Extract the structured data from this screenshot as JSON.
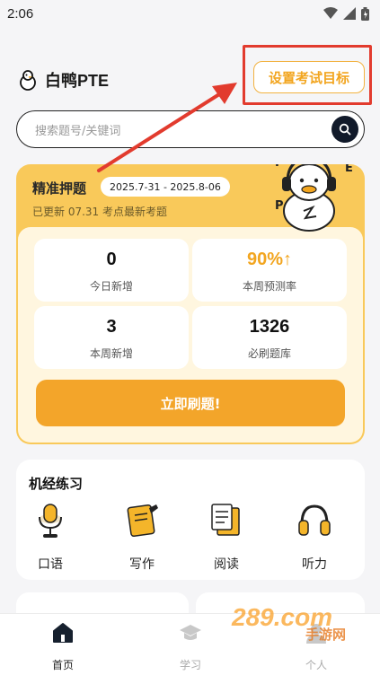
{
  "status_bar": {
    "time": "2:06"
  },
  "header": {
    "app_name": "白鸭PTE",
    "goal_button": "设置考试目标"
  },
  "search": {
    "placeholder": "搜索题号/关键词"
  },
  "exam_card": {
    "title": "精准押题",
    "date_range": "2025.7-31 - 2025.8-06",
    "update_text": "已更新 07.31 考点最新考题",
    "mascot_letters": [
      "T",
      "P",
      "E"
    ],
    "stats": [
      {
        "value": "0",
        "label": "今日新增"
      },
      {
        "value": "90%↑",
        "label": "本周预测率"
      },
      {
        "value": "3",
        "label": "本周新增"
      },
      {
        "value": "1326",
        "label": "必刷题库"
      }
    ],
    "cta": "立即刷题!"
  },
  "practice": {
    "title": "机经练习",
    "items": [
      {
        "label": "口语",
        "icon": "microphone-icon"
      },
      {
        "label": "写作",
        "icon": "notebook-pen-icon"
      },
      {
        "label": "阅读",
        "icon": "reading-paper-icon"
      },
      {
        "label": "听力",
        "icon": "headphones-icon"
      }
    ]
  },
  "bottom_nav": [
    {
      "label": "首页",
      "icon": "home-icon",
      "active": true
    },
    {
      "label": "学习",
      "icon": "graduation-cap-icon",
      "active": false
    },
    {
      "label": "个人",
      "icon": "user-icon",
      "active": false
    }
  ],
  "watermark": {
    "text": "289.com",
    "sub": "手游网"
  },
  "colors": {
    "accent": "#f2a51f",
    "highlight": "#e23b2e",
    "card": "#f9c95a",
    "dark": "#111a2a"
  }
}
